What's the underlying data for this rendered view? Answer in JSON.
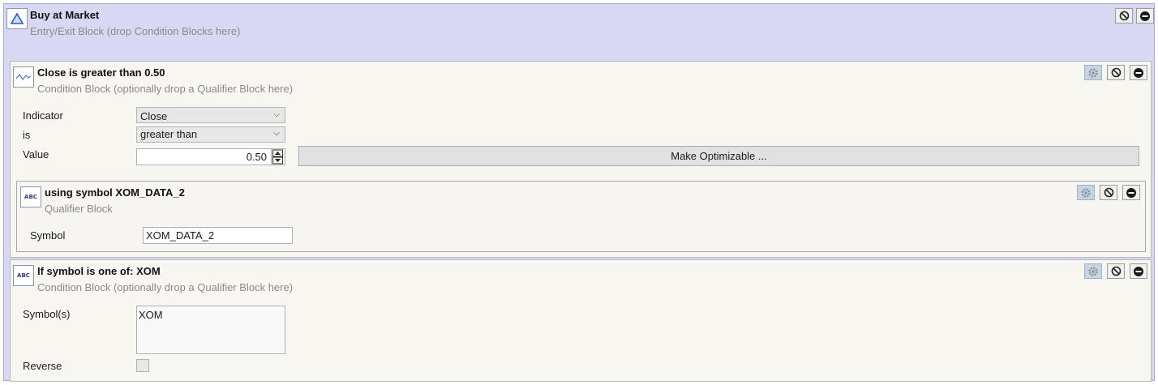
{
  "entry_block": {
    "title": "Buy at Market",
    "subtitle": "Entry/Exit Block (drop Condition Blocks here)"
  },
  "condition1": {
    "title": "Close is greater than 0.50",
    "subtitle": "Condition Block (optionally drop a Qualifier Block here)",
    "indicator_label": "Indicator",
    "indicator_value": "Close",
    "is_label": "is",
    "is_value": "greater than",
    "value_label": "Value",
    "value_value": "0.50",
    "make_optimizable_label": "Make Optimizable ..."
  },
  "qualifier": {
    "title": "using symbol XOM_DATA_2",
    "subtitle": "Qualifier Block",
    "icon_text": "ABC",
    "symbol_label": "Symbol",
    "symbol_value": "XOM_DATA_2"
  },
  "condition2": {
    "title": "If symbol is one of: XOM",
    "subtitle": "Condition Block (optionally drop a Qualifier Block here)",
    "icon_text": "ABC",
    "symbols_label": "Symbol(s)",
    "symbols_value": "XOM",
    "reverse_label": "Reverse",
    "reverse_checked": false
  },
  "icons": {
    "entry_icon": "triangle-icon",
    "condition1_icon": "waveform-icon",
    "gear": "gear-icon",
    "disable": "disable-icon",
    "remove": "remove-icon",
    "dropdown": "chevron-down-icon"
  },
  "colors": {
    "entry_background": "#d8d8f3",
    "condition_background": "#f8f6f0",
    "gear_button_background": "#c7d4e4"
  }
}
